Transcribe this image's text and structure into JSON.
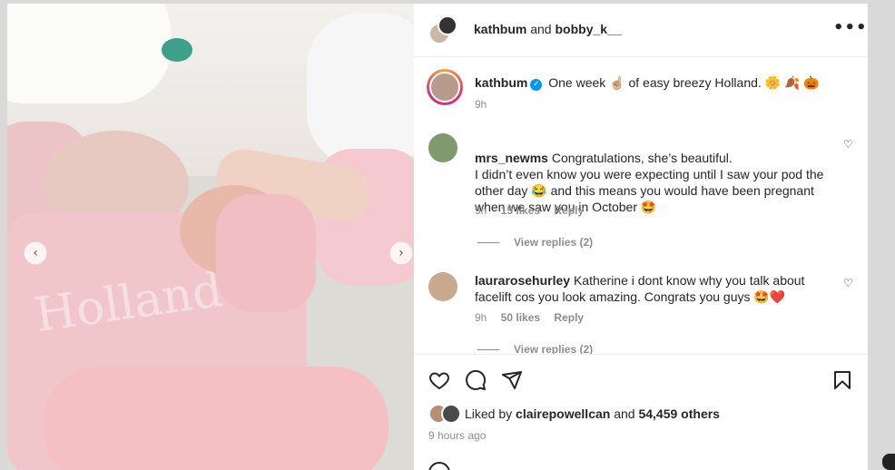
{
  "header": {
    "user1": "kathbum",
    "conjunction": "and",
    "user2": "bobby_k__",
    "more_icon": "more-options-icon"
  },
  "caption": {
    "username": "kathbum",
    "verified_icon": "verified-badge-icon",
    "text": "One week ☝🏼 of easy breezy Holland. 🌼 🍂 🎃",
    "time": "9h"
  },
  "comments": [
    {
      "username": "mrs_newms",
      "text": "Congratulations, she’s beautiful.\nI didn’t even know you were expecting until I saw your pod the other day 😂 and this means you would have been pregnant when we saw you in October 🤩",
      "time": "9h",
      "likes": "15 likes",
      "reply": "Reply",
      "view_replies": "View replies (2)"
    },
    {
      "username": "laurarosehurley",
      "text": "Katherine i dont know why you talk about facelift cos you look amazing. Congrats you guys 🤩❤️",
      "time": "9h",
      "likes": "50 likes",
      "reply": "Reply",
      "view_replies": "View replies (2)"
    }
  ],
  "likes": {
    "prefix": "Liked by",
    "user": "clairepowellcan",
    "and": "and",
    "count": "54,459 others"
  },
  "post_time": "9 hours ago",
  "photo": {
    "prev_icon": "chevron-left-icon",
    "next_icon": "chevron-right-icon"
  },
  "colors": {
    "accent": "#0095f6",
    "text": "#262626",
    "muted": "#8e8e8e"
  }
}
